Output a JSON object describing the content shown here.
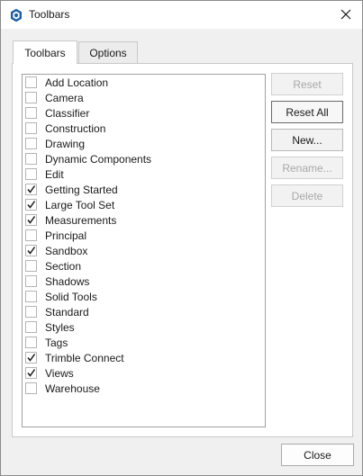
{
  "window": {
    "title": "Toolbars",
    "app_icon": "sketchup-logo-icon",
    "close_icon": "close-icon"
  },
  "tabs": [
    {
      "label": "Toolbars",
      "active": true
    },
    {
      "label": "Options",
      "active": false
    }
  ],
  "toolbars": [
    {
      "label": "Add Location",
      "checked": false
    },
    {
      "label": "Camera",
      "checked": false
    },
    {
      "label": "Classifier",
      "checked": false
    },
    {
      "label": "Construction",
      "checked": false
    },
    {
      "label": "Drawing",
      "checked": false
    },
    {
      "label": "Dynamic Components",
      "checked": false
    },
    {
      "label": "Edit",
      "checked": false
    },
    {
      "label": "Getting Started",
      "checked": true
    },
    {
      "label": "Large Tool Set",
      "checked": true
    },
    {
      "label": "Measurements",
      "checked": true
    },
    {
      "label": "Principal",
      "checked": false
    },
    {
      "label": "Sandbox",
      "checked": true
    },
    {
      "label": "Section",
      "checked": false
    },
    {
      "label": "Shadows",
      "checked": false
    },
    {
      "label": "Solid Tools",
      "checked": false
    },
    {
      "label": "Standard",
      "checked": false
    },
    {
      "label": "Styles",
      "checked": false
    },
    {
      "label": "Tags",
      "checked": false
    },
    {
      "label": "Trimble Connect",
      "checked": true
    },
    {
      "label": "Views",
      "checked": true
    },
    {
      "label": "Warehouse",
      "checked": false
    }
  ],
  "buttons": {
    "reset": {
      "label": "Reset",
      "enabled": false
    },
    "reset_all": {
      "label": "Reset All",
      "enabled": true
    },
    "new": {
      "label": "New...",
      "enabled": true
    },
    "rename": {
      "label": "Rename...",
      "enabled": false
    },
    "delete": {
      "label": "Delete",
      "enabled": false
    }
  },
  "footer": {
    "close_label": "Close"
  }
}
